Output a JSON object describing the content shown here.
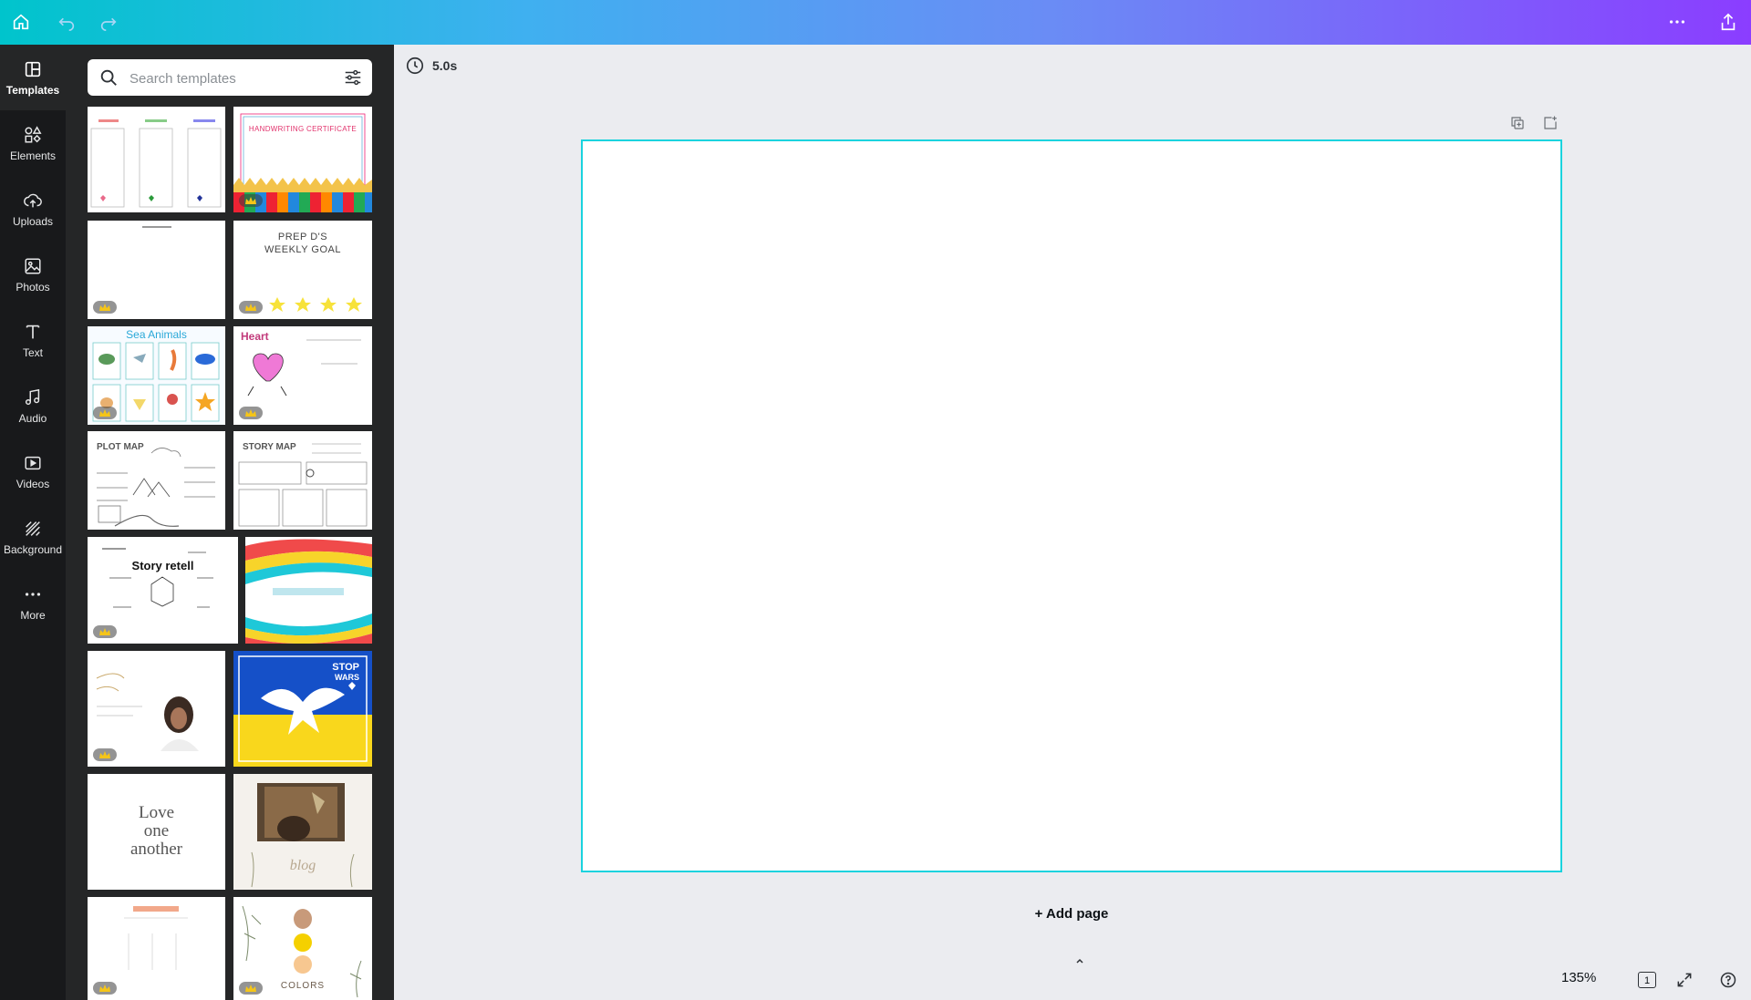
{
  "rail": {
    "items": [
      {
        "label": "Templates",
        "icon": "templates-icon"
      },
      {
        "label": "Elements",
        "icon": "elements-icon"
      },
      {
        "label": "Uploads",
        "icon": "uploads-icon"
      },
      {
        "label": "Photos",
        "icon": "photos-icon"
      },
      {
        "label": "Text",
        "icon": "text-icon"
      },
      {
        "label": "Audio",
        "icon": "audio-icon"
      },
      {
        "label": "Videos",
        "icon": "videos-icon"
      },
      {
        "label": "Background",
        "icon": "background-icon"
      },
      {
        "label": "More",
        "icon": "more-icon"
      }
    ],
    "active": "Templates"
  },
  "search": {
    "placeholder": "Search templates"
  },
  "templates": {
    "t2_title": "HANDWRITING CERTIFICATE",
    "t4_title_line1": "PREP D'S",
    "t4_title_line2": "WEEKLY GOAL",
    "t5_title": "Sea Animals",
    "t6_title": "Heart",
    "t7_title": "PLOT MAP",
    "t8_title": "STORY MAP",
    "t9_title": "Story retell",
    "t12_line1": "STOP",
    "t12_line2": "WARS",
    "t13_line1": "Love",
    "t13_line2": "one",
    "t13_line3": "another",
    "t14_title": "blog",
    "t16_title": "COLORS"
  },
  "timer": {
    "value": "5.0s"
  },
  "add_page": "+ Add page",
  "zoom": "135%",
  "page_count": "1",
  "colors": {
    "canvas_border": "#1ad3de",
    "rail_bg": "#18191b",
    "panel_bg": "#252627"
  }
}
